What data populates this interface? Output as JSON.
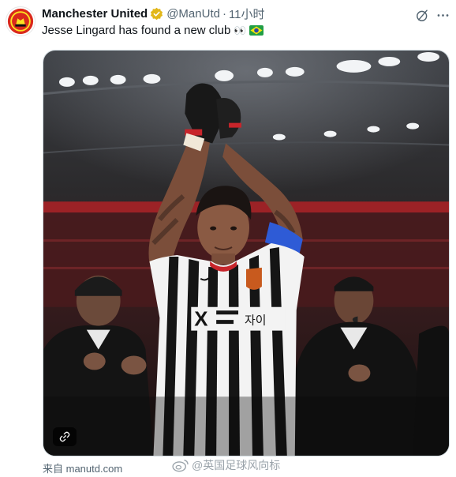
{
  "tweet": {
    "author_name": "Manchester United",
    "handle": "@ManUtd",
    "separator": "·",
    "time": "11小时",
    "text": "Jesse Lingard has found a new club",
    "emojis": "👀",
    "flag_icon": "brazil-flag-icon",
    "verified_icon": "verified-badge-icon",
    "grok_icon": "grok-icon",
    "more_icon": "more-icon"
  },
  "media": {
    "jersey_sponsor": "X 자이",
    "link_icon": "link-icon"
  },
  "card": {
    "source": "来自 manutd.com"
  },
  "watermark": {
    "text": "@英国足球风向标",
    "icon": "weibo-icon"
  },
  "colors": {
    "text_primary": "#0f1419",
    "text_secondary": "#536471",
    "verified_gold": "#e2b719",
    "border": "#cfd9de"
  }
}
